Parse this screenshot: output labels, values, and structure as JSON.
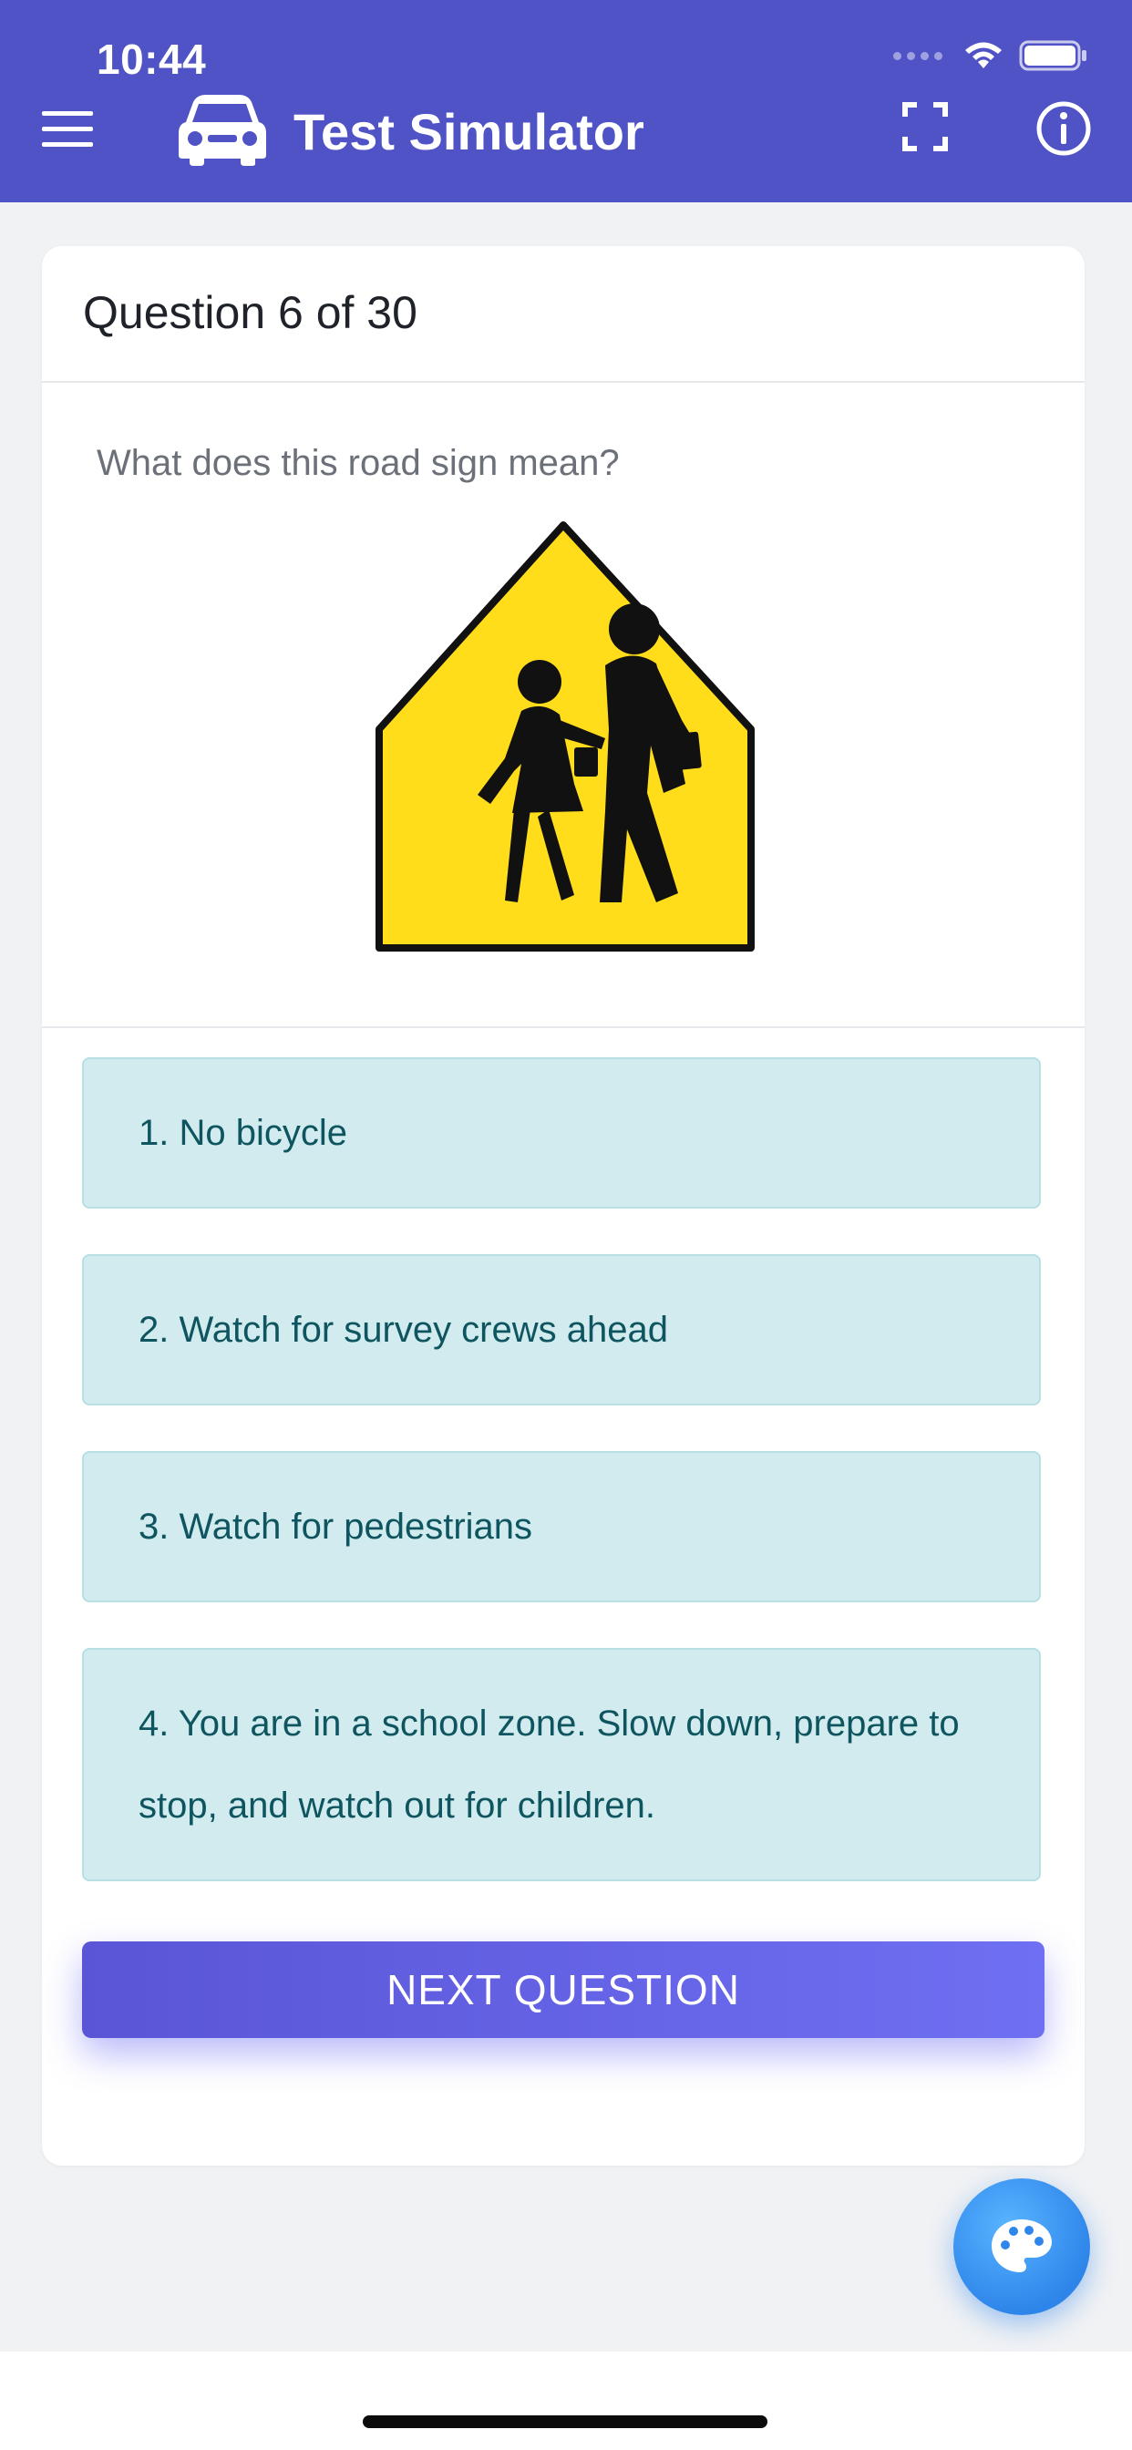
{
  "status_bar": {
    "time": "10:44"
  },
  "toolbar": {
    "title": "Test Simulator",
    "icons": {
      "menu": "hamburger-menu-icon",
      "car": "car-icon",
      "fullscreen": "fullscreen-icon",
      "info": "info-icon"
    }
  },
  "card": {
    "question_counter": "Question 6 of 30",
    "question_text": "What does this road sign mean?",
    "sign_image": "school-crossing-sign",
    "answers": [
      {
        "label": "1. No bicycle"
      },
      {
        "label": "2. Watch for survey crews ahead"
      },
      {
        "label": "3. Watch for pedestrians"
      },
      {
        "label": "4. You are in a school zone. Slow down, prepare to stop, and watch out for children."
      }
    ],
    "next_button": "NEXT QUESTION"
  },
  "fab": {
    "icon": "palette-icon"
  },
  "colors": {
    "header": "#5053c6",
    "answer_bg": "#d1ebee",
    "answer_text": "#0e5560",
    "button_start": "#5a55d6",
    "button_end": "#6f6ff3",
    "fab": "#2f86ea",
    "sign_yellow": "#ffdd1a"
  }
}
